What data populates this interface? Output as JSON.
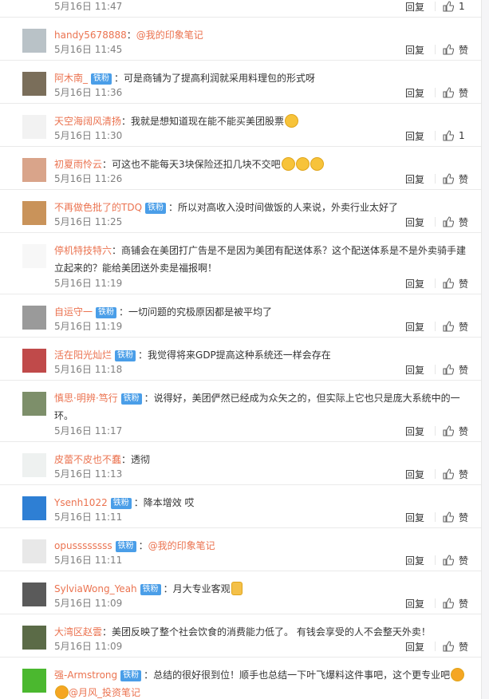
{
  "actions": {
    "reply_label": "回复",
    "like_label": "赞"
  },
  "avatar_palette": [
    "#8ea8b5",
    "#b9c2c7",
    "#7a6e5a",
    "#f2f2f2",
    "#d9a48a",
    "#c9935a",
    "#f7f7f7",
    "#9a9a9a",
    "#c04a4a",
    "#7d8f6a",
    "#eef1f0",
    "#2e7fd4",
    "#e8e8e8",
    "#5a5a5a",
    "#5b6b47",
    "#4bb82f"
  ],
  "comments": [
    {
      "author": "",
      "badge": "",
      "mention": "",
      "text": "",
      "emo": [],
      "time": "5月16日 11:47",
      "likes": "1",
      "height": 38
    },
    {
      "author": "handy5678888",
      "badge": "",
      "mention": "@我的印象笔记",
      "text": "",
      "emo": [],
      "time": "5月16日 11:45",
      "likes": "",
      "height": 53
    },
    {
      "author": "阿木南_",
      "badge": "铁粉",
      "mention": "",
      "text": "：可是商铺为了提高利润就采用料理包的形式呀",
      "emo": [],
      "time": "5月16日 11:36",
      "likes": "",
      "height": 53
    },
    {
      "author": "天空海阔风清扬",
      "badge": "",
      "mention": "",
      "text": "：我就是想知道现在能不能买美团股票",
      "emo": [
        "smile"
      ],
      "time": "5月16日 11:30",
      "likes": "1",
      "height": 53
    },
    {
      "author": "初夏雨怜云",
      "badge": "",
      "mention": "",
      "text": "：可这也不能每天3块保险还扣几块不交吧",
      "emo": [
        "smile",
        "smile",
        "smile"
      ],
      "time": "5月16日 11:26",
      "likes": "",
      "height": 53
    },
    {
      "author": "不再做色批了的TDQ",
      "badge": "铁粉",
      "mention": "",
      "text": "：所以对高收入没时间做饭的人来说，外卖行业太好了",
      "emo": [],
      "time": "5月16日 11:25",
      "likes": "",
      "height": 53
    },
    {
      "author": "停机特技特六",
      "badge": "",
      "mention": "",
      "text": "：商铺会在美团打广告是不是因为美团有配送体系？这个配送体系是不是外卖骑手建立起来的？能给美团送外卖是福报啊！",
      "emo": [],
      "time": "5月16日 11:19",
      "likes": "",
      "height": 76
    },
    {
      "author": "自运守一",
      "badge": "铁粉",
      "mention": "",
      "text": "：一切问题的究极原因都是被平均了",
      "emo": [],
      "time": "5月16日 11:19",
      "likes": "",
      "height": 53
    },
    {
      "author": "活在阳光灿烂",
      "badge": "铁粉",
      "mention": "",
      "text": "：我觉得将来GDP提高这种系统还一样会存在",
      "emo": [],
      "time": "5月16日 11:18",
      "likes": "",
      "height": 53
    },
    {
      "author": "慎思·明辨·笃行",
      "badge": "铁粉",
      "mention": "",
      "text": "：说得好，美团俨然已经成为众矢之的，但实际上它也只是庞大系统中的一环。",
      "emo": [],
      "time": "5月16日 11:17",
      "likes": "",
      "height": 76
    },
    {
      "author": "皮蕾不皮也不蠢",
      "badge": "",
      "mention": "",
      "text": "：透彻",
      "emo": [],
      "time": "5月16日 11:13",
      "likes": "",
      "height": 53
    },
    {
      "author": "Ysenh1022",
      "badge": "铁粉",
      "mention": "",
      "text": "：降本增效 哎",
      "emo": [],
      "time": "5月16日 11:11",
      "likes": "",
      "height": 53
    },
    {
      "author": "opussssssss",
      "badge": "铁粉",
      "mention": "@我的印象笔记",
      "text": "：",
      "emo": [],
      "time": "5月16日 11:11",
      "likes": "",
      "height": 53
    },
    {
      "author": "SylviaWong_Yeah",
      "badge": "铁粉",
      "mention": "",
      "text": "：月大专业客观",
      "emo": [
        "thumb"
      ],
      "time": "5月16日 11:09",
      "likes": "",
      "height": 53
    },
    {
      "author": "大湾区赵雲",
      "badge": "",
      "mention": "",
      "text": "：美团反映了整个社会饮食的消费能力低了。 有钱会享受的人不会整天外卖！",
      "emo": [],
      "time": "5月16日 11:09",
      "likes": "",
      "height": 53
    },
    {
      "author": "强-Armstrong",
      "badge": "铁粉",
      "mention": "@月风_投资笔记",
      "text": "：总结的很好很到位！顺手也总结一下叶飞爆料这件事吧，这个更专业吧",
      "emo": [
        "lol"
      ],
      "emo2": [
        "lol"
      ],
      "time": "5月16日 11:09",
      "likes": "",
      "height": 80
    }
  ]
}
